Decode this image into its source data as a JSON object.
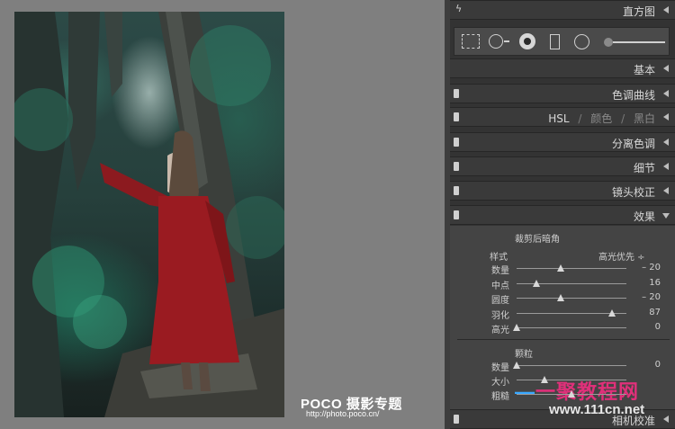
{
  "colors": {
    "panel_bg": "#333333",
    "header_bg": "#3a3a3a",
    "panel_text": "#d8d8d8",
    "preview_bg": "#7f7f7f"
  },
  "preview": {
    "watermark_brand": "POCO 摄影专题",
    "watermark_url": "http://photo.poco.cn/"
  },
  "panels": {
    "histogram": {
      "title": "直方图",
      "icon": "bolt-icon"
    },
    "basic": {
      "title": "基本"
    },
    "tone_curve": {
      "title": "色调曲线"
    },
    "hsl": {
      "hsl": "HSL",
      "sep": "/",
      "color": "颜色",
      "bw": "黑白"
    },
    "split_toning": {
      "title": "分离色调"
    },
    "detail": {
      "title": "细节"
    },
    "lens": {
      "title": "镜头校正"
    },
    "effects": {
      "title": "效果"
    },
    "camera": {
      "title": "相机校准"
    }
  },
  "tools": [
    "crop-overlay-icon",
    "spot-removal-icon",
    "red-eye-icon",
    "graduated-filter-icon",
    "radial-filter-icon",
    "adjustment-brush-icon"
  ],
  "effects": {
    "vignette": {
      "title": "裁剪后暗角",
      "style_label": "样式",
      "style_value": "高光优先 ÷",
      "sliders": [
        {
          "label": "数量",
          "value": "– 20",
          "level": 0.4
        },
        {
          "label": "中点",
          "value": "16",
          "level": 0.18
        },
        {
          "label": "圆度",
          "value": "– 20",
          "level": 0.4
        },
        {
          "label": "羽化",
          "value": "87",
          "level": 0.87
        },
        {
          "label": "高光",
          "value": "0",
          "level": 0.0
        }
      ]
    },
    "grain": {
      "title": "颗粒",
      "sliders": [
        {
          "label": "数量",
          "value": "0",
          "level": 0.0
        },
        {
          "label": "大小",
          "value": "",
          "level": 0.25
        },
        {
          "label": "粗糙",
          "value": "",
          "level": 0.5
        }
      ]
    }
  },
  "overlay_watermark": {
    "site": "一聚教程网",
    "url": "www.111cn.net"
  }
}
